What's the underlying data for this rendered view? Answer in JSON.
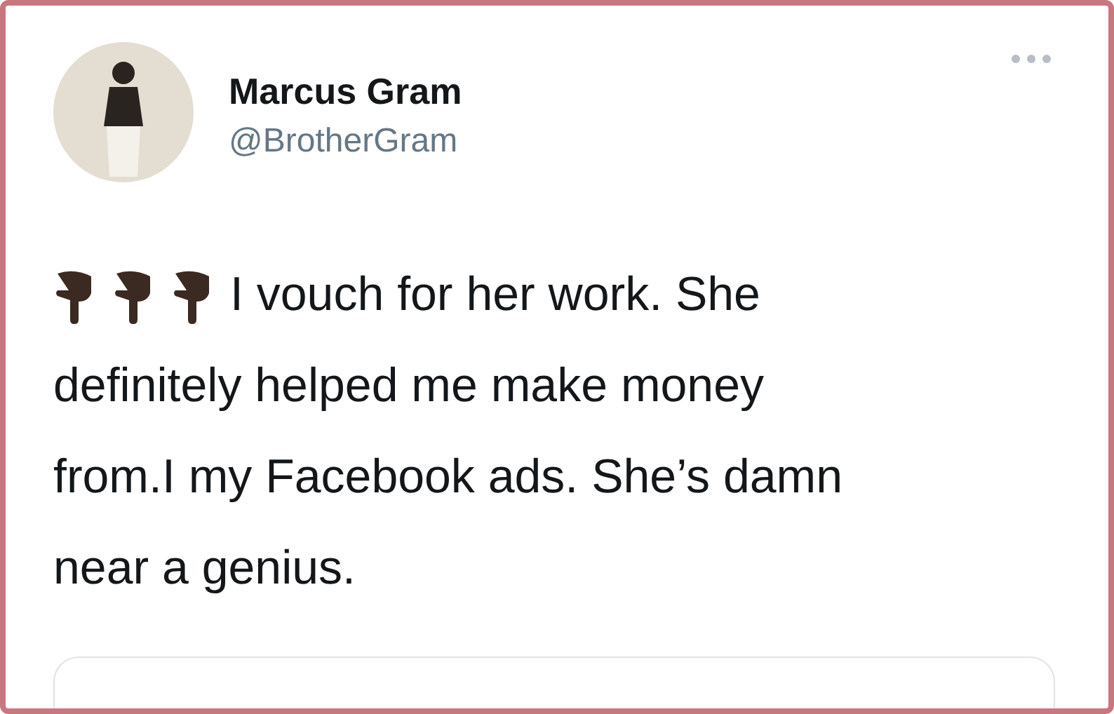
{
  "tweet": {
    "name": "Marcus Gram",
    "handle": "@BrotherGram",
    "lines": [
      "I vouch for her work. She",
      "definitely helped me make money",
      "from.I my Facebook ads. She’s damn",
      "near a genius."
    ]
  }
}
